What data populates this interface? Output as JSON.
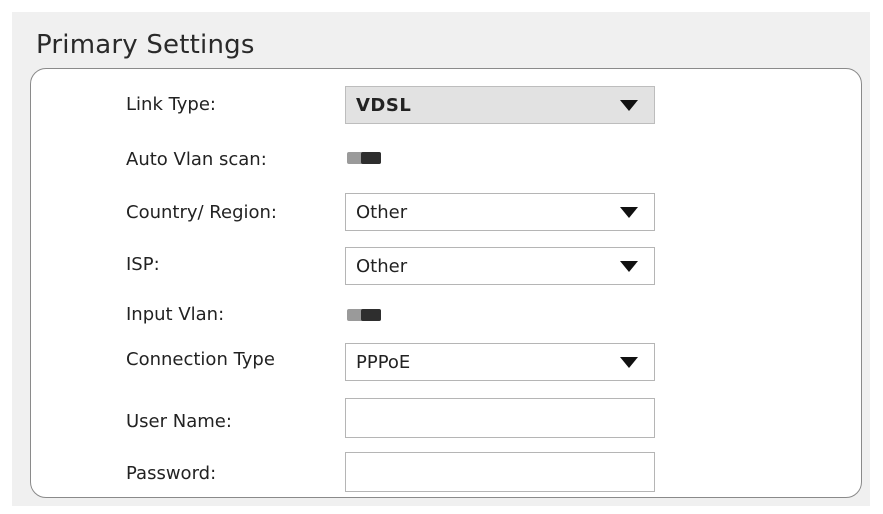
{
  "section": {
    "title": "Primary Settings"
  },
  "fields": {
    "link_type": {
      "label": "Link Type:",
      "value": "VDSL"
    },
    "auto_vlan_scan": {
      "label": "Auto Vlan scan:",
      "state": "off"
    },
    "country_region": {
      "label": "Country/ Region:",
      "value": "Other"
    },
    "isp": {
      "label": "ISP:",
      "value": "Other"
    },
    "input_vlan": {
      "label": "Input Vlan:",
      "state": "off"
    },
    "connection_type": {
      "label": "Connection Type",
      "value": "PPPoE"
    },
    "user_name": {
      "label": "User Name:",
      "value": ""
    },
    "password": {
      "label": "Password:",
      "value": ""
    }
  },
  "icons": {
    "dropdown": "caret-down-icon"
  },
  "colors": {
    "panel_bg": "#f0f0f0",
    "card_border": "#8a8a8a",
    "disabled_select_bg": "#e2e2e2",
    "toggle_track": "#9a9a9a",
    "toggle_knob": "#2e2e2e"
  }
}
